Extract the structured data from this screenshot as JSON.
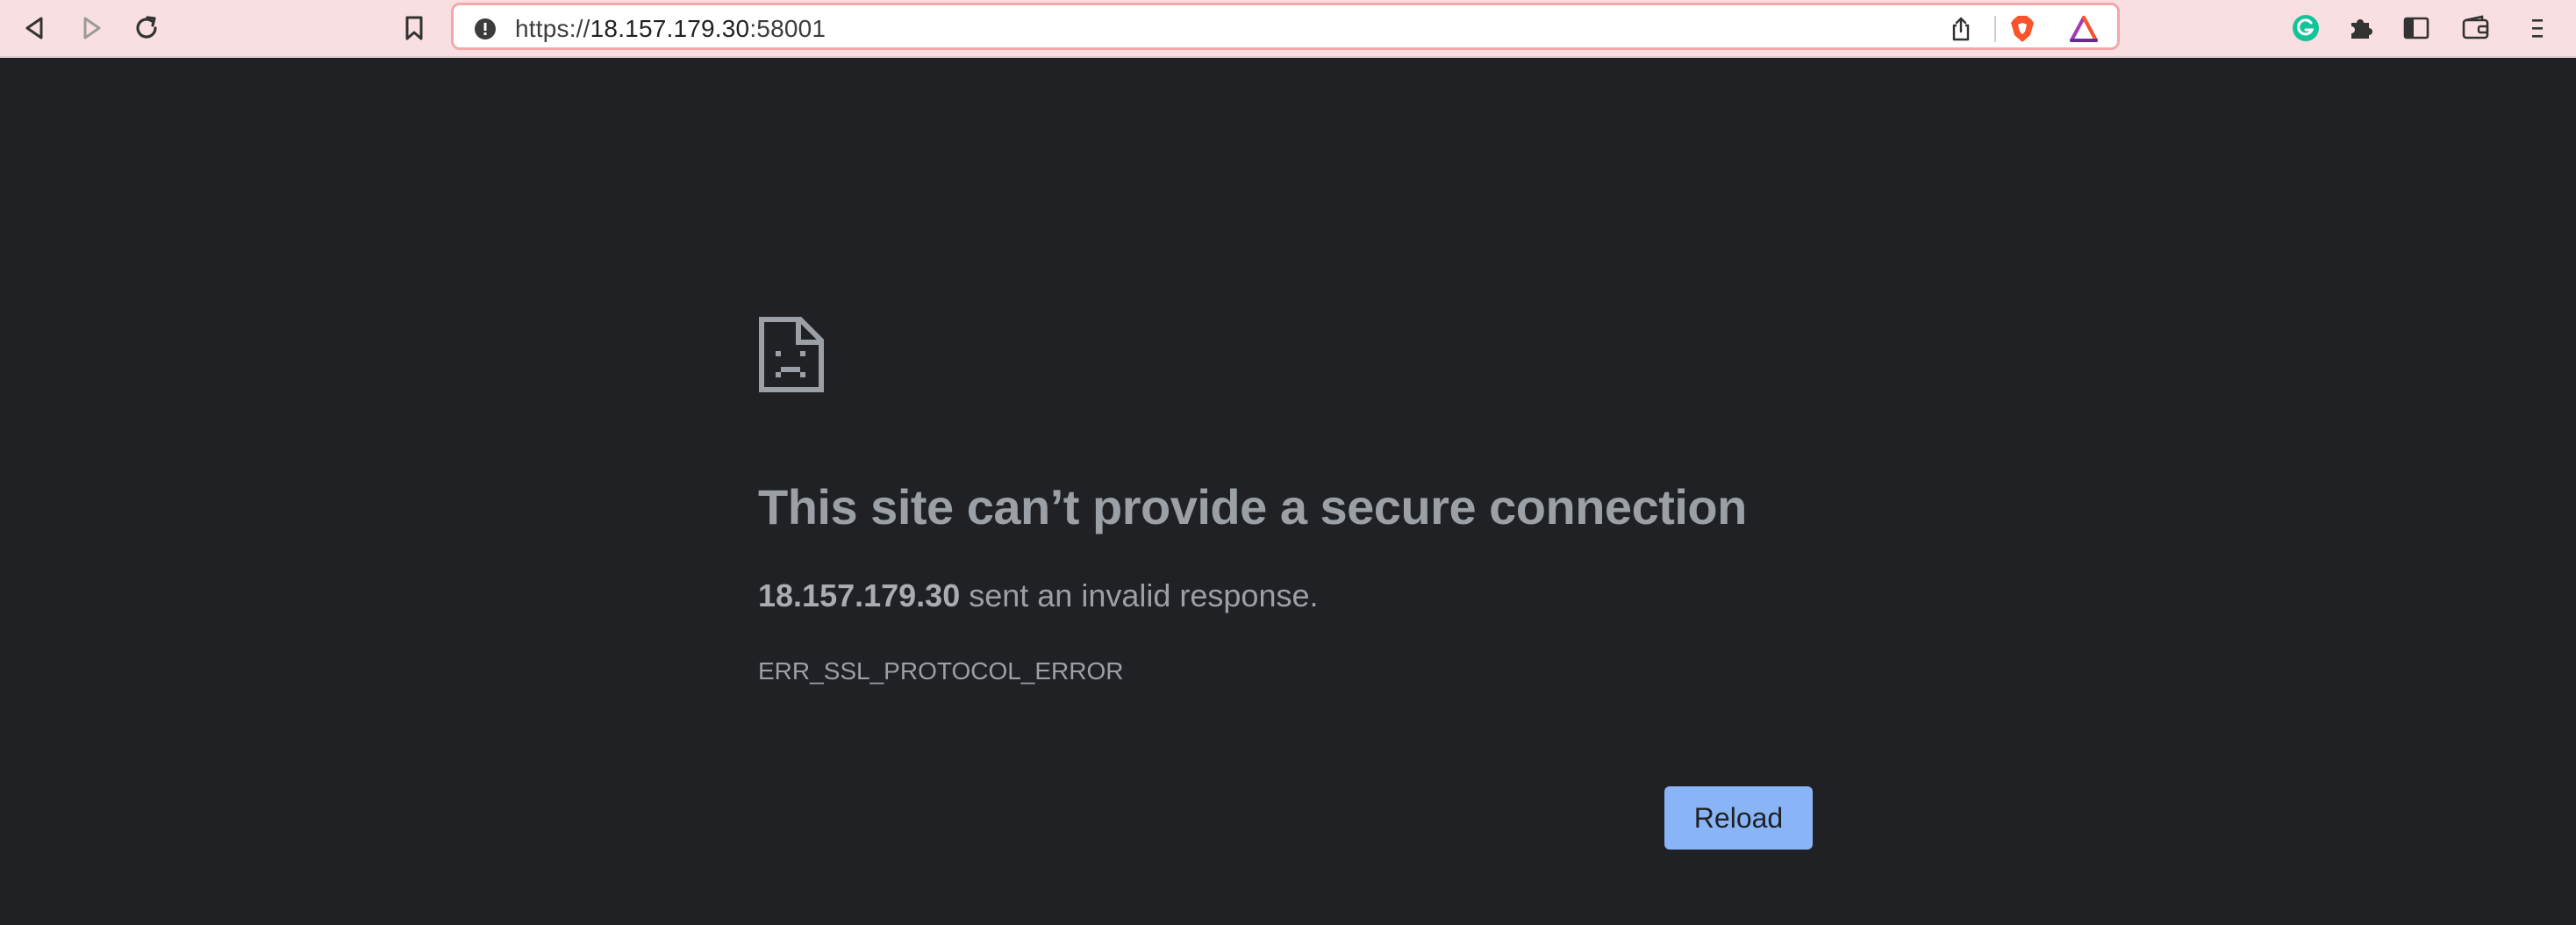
{
  "toolbar": {
    "back_icon": "back-arrow-icon",
    "forward_icon": "forward-arrow-icon",
    "reload_icon": "reload-icon",
    "bookmark_icon": "bookmark-icon",
    "url_scheme": "https://",
    "url_host": "18.157.179.30",
    "url_port": ":58001",
    "security_icon": "not-secure-icon",
    "share_icon": "share-icon",
    "brave_shields_icon": "brave-shields-icon",
    "brave_rewards_icon": "brave-rewards-icon",
    "grammarly_icon": "grammarly-icon",
    "extensions_icon": "puzzle-icon",
    "sidebar_icon": "sidebar-icon",
    "wallet_icon": "wallet-icon",
    "menu_icon": "menu-icon",
    "colors": {
      "background": "#f9dfe1",
      "omnibox_border": "#f2a8a8"
    }
  },
  "error_page": {
    "icon": "sad-file-icon",
    "title": "This site can’t provide a secure connection",
    "host": "18.157.179.30",
    "message": " sent an invalid response.",
    "error_code": "ERR_SSL_PROTOCOL_ERROR",
    "reload_label": "Reload",
    "colors": {
      "background": "#202124",
      "text": "#9aa0a6",
      "button": "#8ab4f8"
    }
  }
}
